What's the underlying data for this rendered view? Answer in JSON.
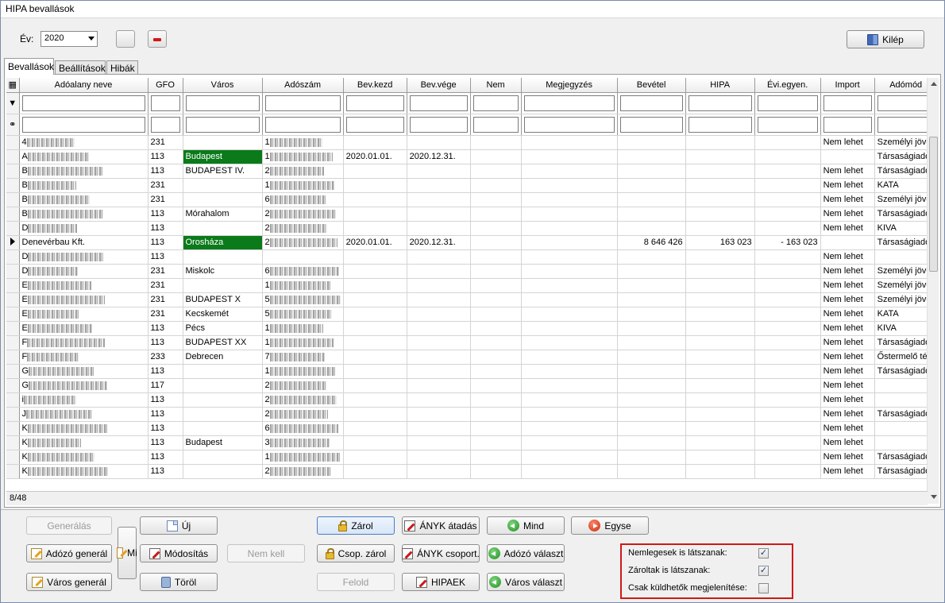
{
  "window": {
    "title": "HIPA bevallások"
  },
  "toolbar": {
    "year_label": "Év:",
    "year_value": "2020",
    "exit_label": "Kilép"
  },
  "tabs": [
    {
      "label": "Bevallások",
      "active": true
    },
    {
      "label": "Beállítások",
      "active": false
    },
    {
      "label": "Hibák",
      "active": false
    }
  ],
  "grid": {
    "columns": [
      "Adóalany neve",
      "GFO",
      "Város",
      "Adószám",
      "Bev.kezd",
      "Bev.vége",
      "Nem",
      "Megjegyzés",
      "Bevétel",
      "HIPA",
      "Évi.egyen.",
      "Import",
      "Adómód"
    ],
    "rows": [
      {
        "name": "4",
        "gfo": "231",
        "varos": "",
        "adoszam": "1",
        "kezd": "",
        "vege": "",
        "nem": "",
        "megj": "",
        "bevetel": "",
        "hipa": "",
        "evi": "",
        "import": "Nem lehet",
        "adomod": "Személyi jöve",
        "current": false,
        "green": false
      },
      {
        "name": "A",
        "gfo": "113",
        "varos": "Budapest",
        "adoszam": "1",
        "kezd": "2020.01.01.",
        "vege": "2020.12.31.",
        "nem": "",
        "megj": "",
        "bevetel": "",
        "hipa": "",
        "evi": "",
        "import": "",
        "adomod": "Társaságiadó",
        "current": false,
        "green": true
      },
      {
        "name": "B",
        "gfo": "113",
        "varos": "BUDAPEST IV.",
        "adoszam": "2",
        "kezd": "",
        "vege": "",
        "nem": "",
        "megj": "",
        "bevetel": "",
        "hipa": "",
        "evi": "",
        "import": "Nem lehet",
        "adomod": "Társaságiadó",
        "current": false,
        "green": false
      },
      {
        "name": "B",
        "gfo": "231",
        "varos": "",
        "adoszam": "1",
        "kezd": "",
        "vege": "",
        "nem": "",
        "megj": "",
        "bevetel": "",
        "hipa": "",
        "evi": "",
        "import": "Nem lehet",
        "adomod": "KATA",
        "current": false,
        "green": false
      },
      {
        "name": "B",
        "gfo": "231",
        "varos": "",
        "adoszam": "6",
        "kezd": "",
        "vege": "",
        "nem": "",
        "megj": "",
        "bevetel": "",
        "hipa": "",
        "evi": "",
        "import": "Nem lehet",
        "adomod": "Személyi jöve",
        "current": false,
        "green": false
      },
      {
        "name": "B",
        "gfo": "113",
        "varos": "Mórahalom",
        "adoszam": "2",
        "kezd": "",
        "vege": "",
        "nem": "",
        "megj": "",
        "bevetel": "",
        "hipa": "",
        "evi": "",
        "import": "Nem lehet",
        "adomod": "Társaságiadó",
        "current": false,
        "green": false
      },
      {
        "name": "D",
        "gfo": "113",
        "varos": "",
        "adoszam": "2",
        "kezd": "",
        "vege": "",
        "nem": "",
        "megj": "",
        "bevetel": "",
        "hipa": "",
        "evi": "",
        "import": "Nem lehet",
        "adomod": "KIVA",
        "current": false,
        "green": false
      },
      {
        "name": "Denevérbau Kft.",
        "gfo": "113",
        "varos": "Orosháza",
        "adoszam": "2",
        "kezd": "2020.01.01.",
        "vege": "2020.12.31.",
        "nem": "",
        "megj": "",
        "bevetel": "8 646 426",
        "hipa": "163 023",
        "evi": "- 163 023",
        "import": "",
        "adomod": "Társaságiadó",
        "current": true,
        "green": true
      },
      {
        "name": "D",
        "gfo": "113",
        "varos": "",
        "adoszam": "",
        "kezd": "",
        "vege": "",
        "nem": "",
        "megj": "",
        "bevetel": "",
        "hipa": "",
        "evi": "",
        "import": "Nem lehet",
        "adomod": "",
        "current": false,
        "green": false
      },
      {
        "name": "D",
        "gfo": "231",
        "varos": "Miskolc",
        "adoszam": "6",
        "kezd": "",
        "vege": "",
        "nem": "",
        "megj": "",
        "bevetel": "",
        "hipa": "",
        "evi": "",
        "import": "Nem lehet",
        "adomod": "Személyi jöve",
        "current": false,
        "green": false
      },
      {
        "name": "E",
        "gfo": "231",
        "varos": "",
        "adoszam": "1",
        "kezd": "",
        "vege": "",
        "nem": "",
        "megj": "",
        "bevetel": "",
        "hipa": "",
        "evi": "",
        "import": "Nem lehet",
        "adomod": "Személyi jöve",
        "current": false,
        "green": false
      },
      {
        "name": "E",
        "gfo": "231",
        "varos": "BUDAPEST X",
        "adoszam": "5",
        "kezd": "",
        "vege": "",
        "nem": "",
        "megj": "",
        "bevetel": "",
        "hipa": "",
        "evi": "",
        "import": "Nem lehet",
        "adomod": "Személyi jöve",
        "current": false,
        "green": false
      },
      {
        "name": "E",
        "gfo": "231",
        "varos": "Kecskemét",
        "adoszam": "5",
        "kezd": "",
        "vege": "",
        "nem": "",
        "megj": "",
        "bevetel": "",
        "hipa": "",
        "evi": "",
        "import": "Nem lehet",
        "adomod": "KATA",
        "current": false,
        "green": false
      },
      {
        "name": "E",
        "gfo": "113",
        "varos": "Pécs",
        "adoszam": "1",
        "kezd": "",
        "vege": "",
        "nem": "",
        "megj": "",
        "bevetel": "",
        "hipa": "",
        "evi": "",
        "import": "Nem lehet",
        "adomod": "KIVA",
        "current": false,
        "green": false
      },
      {
        "name": "F",
        "gfo": "113",
        "varos": "BUDAPEST XX",
        "adoszam": "1",
        "kezd": "",
        "vege": "",
        "nem": "",
        "megj": "",
        "bevetel": "",
        "hipa": "",
        "evi": "",
        "import": "Nem lehet",
        "adomod": "Társaságiadó",
        "current": false,
        "green": false
      },
      {
        "name": "F",
        "gfo": "233",
        "varos": "Debrecen",
        "adoszam": "7",
        "kezd": "",
        "vege": "",
        "nem": "",
        "megj": "",
        "bevetel": "",
        "hipa": "",
        "evi": "",
        "import": "Nem lehet",
        "adomod": "Őstermelő téte",
        "current": false,
        "green": false
      },
      {
        "name": "G",
        "gfo": "113",
        "varos": "",
        "adoszam": "1",
        "kezd": "",
        "vege": "",
        "nem": "",
        "megj": "",
        "bevetel": "",
        "hipa": "",
        "evi": "",
        "import": "Nem lehet",
        "adomod": "Társaságiadó",
        "current": false,
        "green": false
      },
      {
        "name": "G",
        "gfo": "117",
        "varos": "",
        "adoszam": "2",
        "kezd": "",
        "vege": "",
        "nem": "",
        "megj": "",
        "bevetel": "",
        "hipa": "",
        "evi": "",
        "import": "Nem lehet",
        "adomod": "",
        "current": false,
        "green": false
      },
      {
        "name": "i",
        "gfo": "113",
        "varos": "",
        "adoszam": "2",
        "kezd": "",
        "vege": "",
        "nem": "",
        "megj": "",
        "bevetel": "",
        "hipa": "",
        "evi": "",
        "import": "Nem lehet",
        "adomod": "",
        "current": false,
        "green": false
      },
      {
        "name": "J",
        "gfo": "113",
        "varos": "",
        "adoszam": "2",
        "kezd": "",
        "vege": "",
        "nem": "",
        "megj": "",
        "bevetel": "",
        "hipa": "",
        "evi": "",
        "import": "Nem lehet",
        "adomod": "Társaságiadó",
        "current": false,
        "green": false
      },
      {
        "name": "K",
        "gfo": "113",
        "varos": "",
        "adoszam": "6",
        "kezd": "",
        "vege": "",
        "nem": "",
        "megj": "",
        "bevetel": "",
        "hipa": "",
        "evi": "",
        "import": "Nem lehet",
        "adomod": "",
        "current": false,
        "green": false
      },
      {
        "name": "K",
        "gfo": "113",
        "varos": "Budapest",
        "adoszam": "3",
        "kezd": "",
        "vege": "",
        "nem": "",
        "megj": "",
        "bevetel": "",
        "hipa": "",
        "evi": "",
        "import": "Nem lehet",
        "adomod": "",
        "current": false,
        "green": false
      },
      {
        "name": "K",
        "gfo": "113",
        "varos": "",
        "adoszam": "1",
        "kezd": "",
        "vege": "",
        "nem": "",
        "megj": "",
        "bevetel": "",
        "hipa": "",
        "evi": "",
        "import": "Nem lehet",
        "adomod": "Társaságiadó",
        "current": false,
        "green": false
      },
      {
        "name": "K",
        "gfo": "113",
        "varos": "",
        "adoszam": "2",
        "kezd": "",
        "vege": "",
        "nem": "",
        "megj": "",
        "bevetel": "",
        "hipa": "",
        "evi": "",
        "import": "Nem lehet",
        "adomod": "Társaságiadó",
        "current": false,
        "green": false
      }
    ],
    "record_counter": "8/48"
  },
  "buttons": {
    "generalas": "Generálás",
    "adozo_general": "Adózó generál",
    "varos_general": "Város generál",
    "mi": "Mi",
    "uj": "Új",
    "modositas": "Módosítás",
    "torol": "Töröl",
    "nem_kell": "Nem kell",
    "zarol": "Zárol",
    "csop_zarol": "Csop. zárol",
    "felold": "Felold",
    "anyk_atadas": "ÁNYK átadás",
    "anyk_csoport": "ÁNYK csoport.",
    "hipaek": "HIPAEK",
    "mind": "Mind",
    "adozo_valaszt": "Adózó választ",
    "varos_valaszt": "Város választ",
    "egyse": "Egyse"
  },
  "options": [
    {
      "label": "Nemlegesek is látszanak:",
      "checked": true
    },
    {
      "label": "Zároltak is látszanak:",
      "checked": true
    },
    {
      "label": "Csak küldhetők megjelenítése:",
      "checked": false
    }
  ]
}
